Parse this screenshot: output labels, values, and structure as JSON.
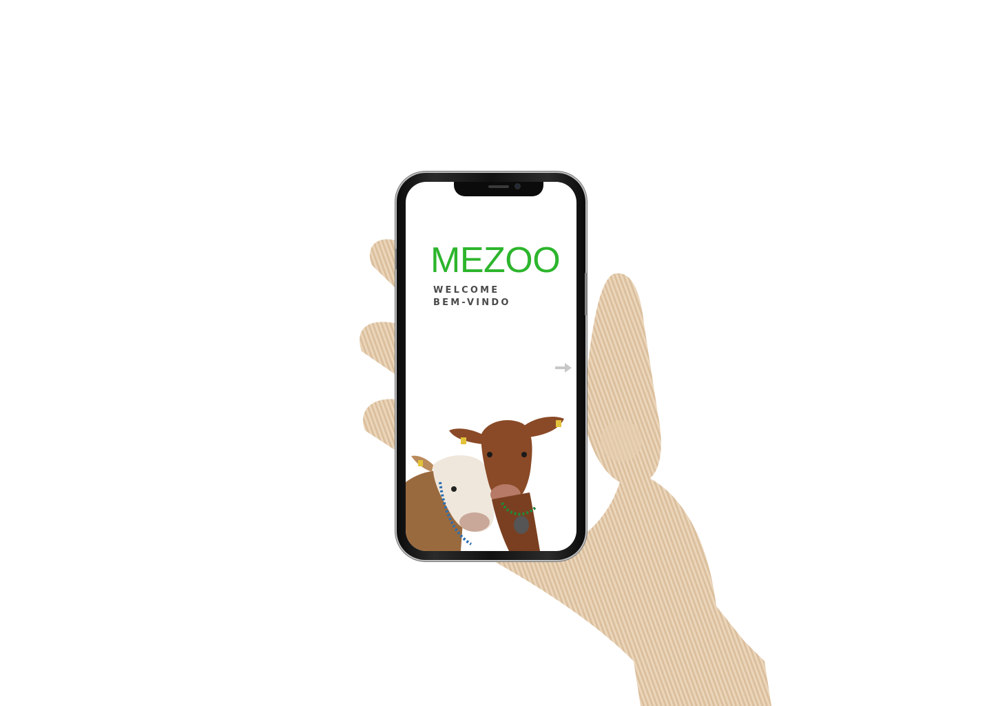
{
  "app": {
    "brand_name": "MEZOO",
    "brand_color": "#2db52d",
    "welcome_en": "WELCOME",
    "welcome_pt": "BEM-VINDO"
  },
  "navigation": {
    "next_icon": "arrow-right-icon"
  },
  "colors": {
    "background": "#ffffff",
    "text_secondary": "#4a4a4a",
    "arrow": "#c8c8c8"
  }
}
